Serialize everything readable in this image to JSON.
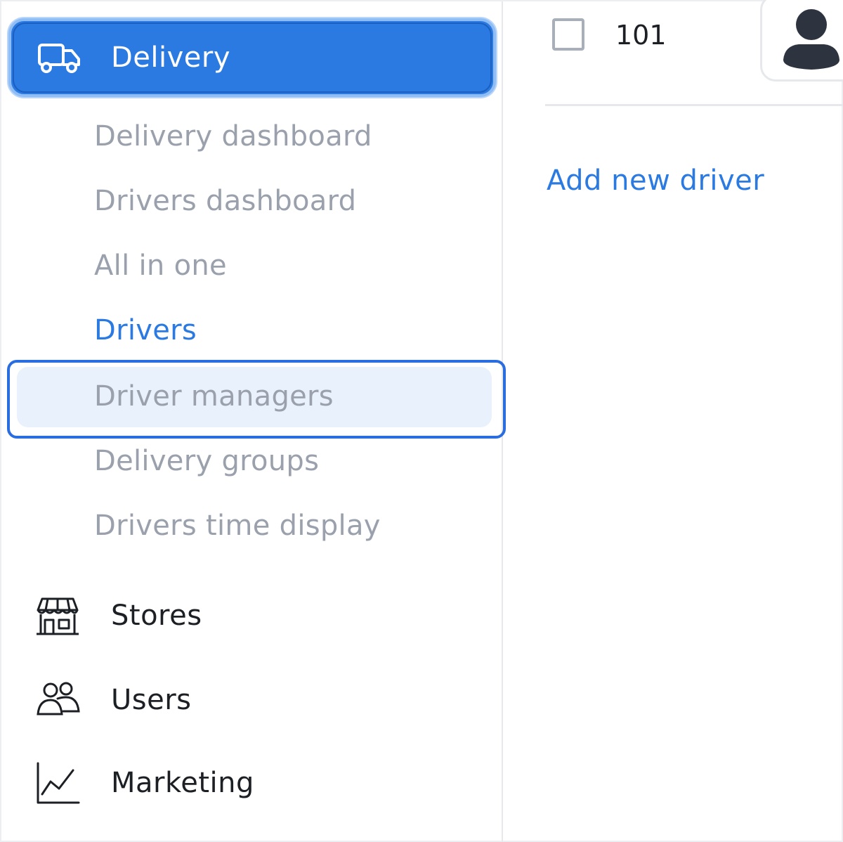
{
  "sidebar": {
    "active_section": {
      "label": "Delivery",
      "icon": "truck-icon"
    },
    "sub_items": [
      {
        "label": "Delivery dashboard",
        "state": "default"
      },
      {
        "label": "Drivers dashboard",
        "state": "default"
      },
      {
        "label": "All in one",
        "state": "default"
      },
      {
        "label": "Drivers",
        "state": "active"
      },
      {
        "label": "Driver managers",
        "state": "highlighted"
      },
      {
        "label": "Delivery groups",
        "state": "default"
      },
      {
        "label": "Drivers time display",
        "state": "default"
      }
    ],
    "main_items": [
      {
        "label": "Stores",
        "icon": "store-icon"
      },
      {
        "label": "Users",
        "icon": "users-icon"
      },
      {
        "label": "Marketing",
        "icon": "chart-line-icon"
      }
    ]
  },
  "main": {
    "row": {
      "checked": false,
      "number": "101",
      "avatar_icon": "user-avatar-icon"
    },
    "add_driver_link": "Add new driver"
  },
  "colors": {
    "accent": "#2a7ae2",
    "muted_text": "#9aa1ad",
    "dark_text": "#1c1f24",
    "highlight_border": "#2a6de0",
    "highlight_fill": "#e9f1fd"
  }
}
